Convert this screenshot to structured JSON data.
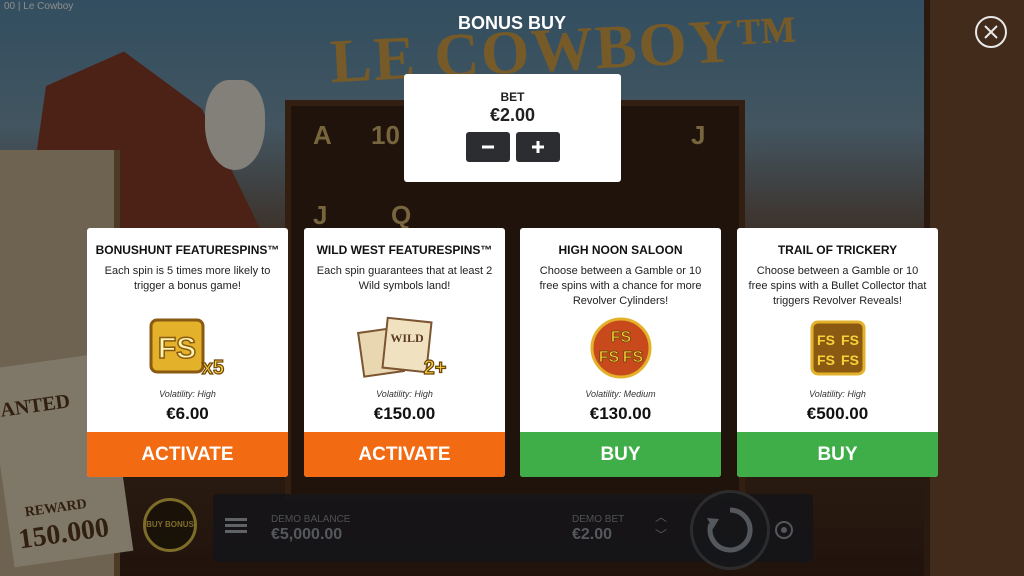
{
  "window": {
    "title": "00 | Le Cowboy"
  },
  "scene": {
    "logo": "LE COWBOY™",
    "wanted_text": "ANTED",
    "reward_label": "REWARD",
    "reward_amount": "150.000",
    "reel_symbols": [
      "A",
      "10",
      "J",
      "Q"
    ]
  },
  "modal": {
    "title": "BONUS BUY",
    "bet": {
      "label": "BET",
      "value": "€2.00",
      "minus": "−",
      "plus": "+"
    },
    "cards": [
      {
        "title": "BONUSHUNT FEATURESPINS™",
        "description": "Each spin is 5 times more likely to trigger a bonus game!",
        "art_text": "FS",
        "art_badge": "x5",
        "volatility": "Volatility: High",
        "price": "€6.00",
        "action": "ACTIVATE",
        "action_color": "#f26a12"
      },
      {
        "title": "WILD WEST FEATURESPINS™",
        "description": "Each spin guarantees that at least 2 Wild symbols land!",
        "art_text": "WILD",
        "art_badge": "2+",
        "volatility": "Volatility: High",
        "price": "€150.00",
        "action": "ACTIVATE",
        "action_color": "#f26a12"
      },
      {
        "title": "HIGH NOON SALOON",
        "description": "Choose between a Gamble or 10 free spins with a chance for more Revolver Cylinders!",
        "art_text": "FS",
        "art_badge": "",
        "volatility": "Volatility: Medium",
        "price": "€130.00",
        "action": "BUY",
        "action_color": "#3fae49"
      },
      {
        "title": "TRAIL OF TRICKERY",
        "description": "Choose between a Gamble or 10 free spins with a Bullet Collector that triggers Revolver Reveals!",
        "art_text": "FS",
        "art_badge": "",
        "volatility": "Volatility: High",
        "price": "€500.00",
        "action": "BUY",
        "action_color": "#3fae49"
      }
    ]
  },
  "hud": {
    "balance_label": "DEMO BALANCE",
    "balance_value": "€5,000.00",
    "bet_label": "DEMO BET",
    "bet_value": "€2.00",
    "buy_bonus_label": "BUY BONUS"
  },
  "colors": {
    "activate": "#f26a12",
    "buy": "#3fae49",
    "gold": "#e3b12a"
  }
}
